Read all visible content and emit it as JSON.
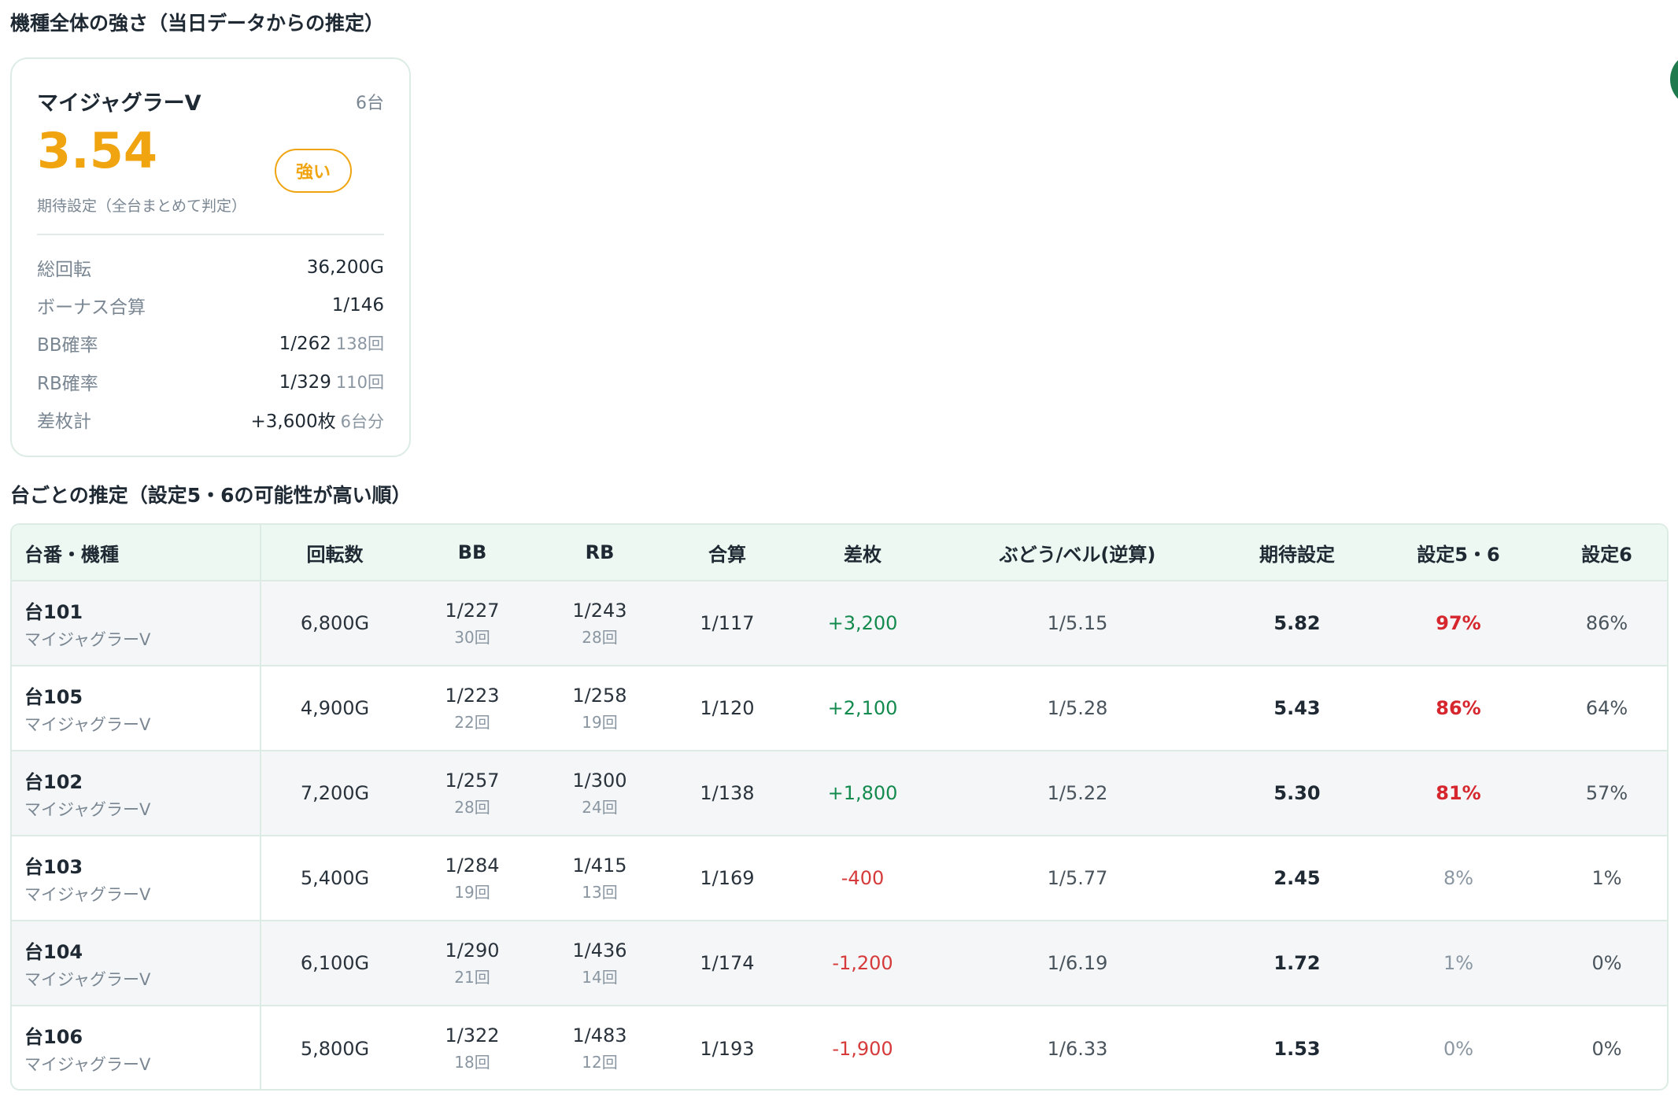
{
  "summary": {
    "title": "機種全体の強さ（当日データからの推定）",
    "card": {
      "model": "マイジャグラーV",
      "count": "6台",
      "score": "3.54",
      "score_caption": "期待設定（全台まとめて判定）",
      "badge": "強い",
      "stats": [
        {
          "label": "総回転",
          "value": "36,200G",
          "sub": ""
        },
        {
          "label": "ボーナス合算",
          "value": "1/146",
          "sub": ""
        },
        {
          "label": "BB確率",
          "value": "1/262",
          "sub": "138回"
        },
        {
          "label": "RB確率",
          "value": "1/329",
          "sub": "110回"
        },
        {
          "label": "差枚計",
          "value": "+3,600枚",
          "sub": "6台分"
        }
      ]
    }
  },
  "table": {
    "title": "台ごとの推定（設定5・6の可能性が高い順）",
    "headers": [
      "台番・機種",
      "回転数",
      "BB",
      "RB",
      "合算",
      "差枚",
      "ぶどう/ベル(逆算)",
      "期待設定",
      "設定5・6",
      "設定6"
    ],
    "rows": [
      {
        "id": "台101",
        "model": "マイジャグラーV",
        "spins": "6,800G",
        "bb": "1/227",
        "bb_count": "30回",
        "rb": "1/243",
        "rb_count": "28回",
        "total": "1/117",
        "diff": "+3,200",
        "grape": "1/5.15",
        "expect": "5.82",
        "p56": "97%",
        "p6": "86%"
      },
      {
        "id": "台105",
        "model": "マイジャグラーV",
        "spins": "4,900G",
        "bb": "1/223",
        "bb_count": "22回",
        "rb": "1/258",
        "rb_count": "19回",
        "total": "1/120",
        "diff": "+2,100",
        "grape": "1/5.28",
        "expect": "5.43",
        "p56": "86%",
        "p6": "64%"
      },
      {
        "id": "台102",
        "model": "マイジャグラーV",
        "spins": "7,200G",
        "bb": "1/257",
        "bb_count": "28回",
        "rb": "1/300",
        "rb_count": "24回",
        "total": "1/138",
        "diff": "+1,800",
        "grape": "1/5.22",
        "expect": "5.30",
        "p56": "81%",
        "p6": "57%"
      },
      {
        "id": "台103",
        "model": "マイジャグラーV",
        "spins": "5,400G",
        "bb": "1/284",
        "bb_count": "19回",
        "rb": "1/415",
        "rb_count": "13回",
        "total": "1/169",
        "diff": "-400",
        "grape": "1/5.77",
        "expect": "2.45",
        "p56": "8%",
        "p6": "1%"
      },
      {
        "id": "台104",
        "model": "マイジャグラーV",
        "spins": "6,100G",
        "bb": "1/290",
        "bb_count": "21回",
        "rb": "1/436",
        "rb_count": "14回",
        "total": "1/174",
        "diff": "-1,200",
        "grape": "1/6.19",
        "expect": "1.72",
        "p56": "1%",
        "p6": "0%"
      },
      {
        "id": "台106",
        "model": "マイジャグラーV",
        "spins": "5,800G",
        "bb": "1/322",
        "bb_count": "18回",
        "rb": "1/483",
        "rb_count": "12回",
        "total": "1/193",
        "diff": "-1,900",
        "grape": "1/6.33",
        "expect": "1.53",
        "p56": "0%",
        "p6": "0%"
      }
    ]
  },
  "colors": {
    "accent_orange": "#f0a410",
    "positive": "#138a4e",
    "negative": "#d63a3a",
    "header_bg": "#ecf8f1",
    "edge_button": "#1f7a4d"
  }
}
